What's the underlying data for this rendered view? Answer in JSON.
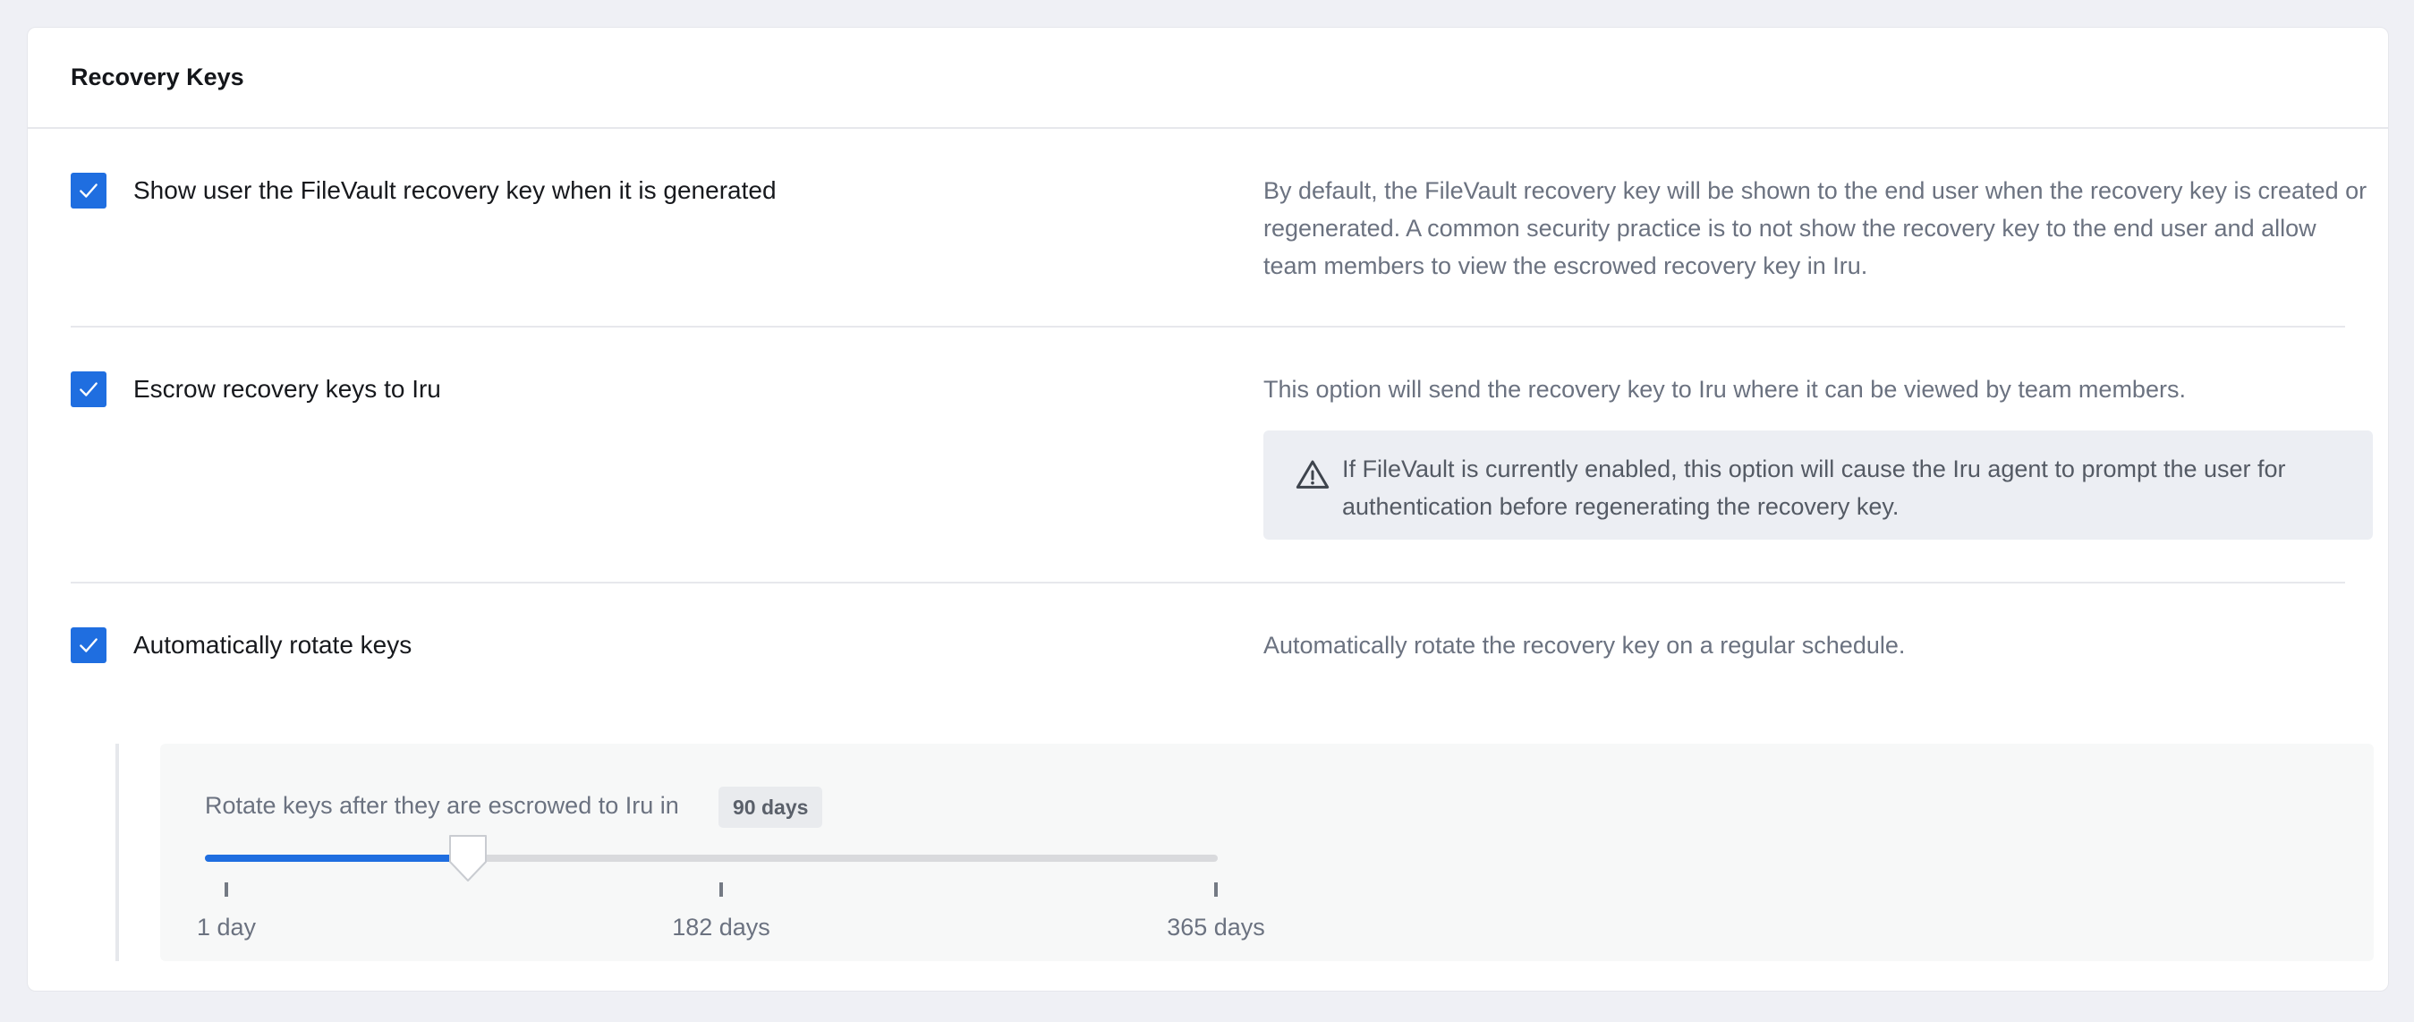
{
  "card": {
    "title": "Recovery Keys"
  },
  "options": [
    {
      "label": "Show user the FileVault recovery key when it is generated",
      "checked": true,
      "description": "By default, the FileVault recovery key will be shown to the end user when the recovery key is created or regenerated. A common security practice is to not show the recovery key to the end user and allow team members to view the escrowed recovery key in Iru."
    },
    {
      "label": "Escrow recovery keys to Iru",
      "checked": true,
      "description": "This option will send the recovery key to Iru where it can be viewed by team members.",
      "warning": "If FileVault is currently enabled, this option will cause the Iru agent to prompt the user for authentication before regenerating the recovery key."
    },
    {
      "label": "Automatically rotate keys",
      "checked": true,
      "description": "Automatically rotate the recovery key on a regular schedule."
    }
  ],
  "rotation": {
    "label": "Rotate keys after they are escrowed to Iru in",
    "value_badge": "90 days",
    "value_days": 90,
    "min_days": 1,
    "max_days": 365,
    "ticks": [
      "1 day",
      "182 days",
      "365 days"
    ]
  },
  "colors": {
    "accent": "#1f6ee0",
    "background": "#eff0f5",
    "muted_text": "#6b7280"
  },
  "icons": {
    "checkbox": "check-icon",
    "warning": "warning-triangle-icon"
  }
}
